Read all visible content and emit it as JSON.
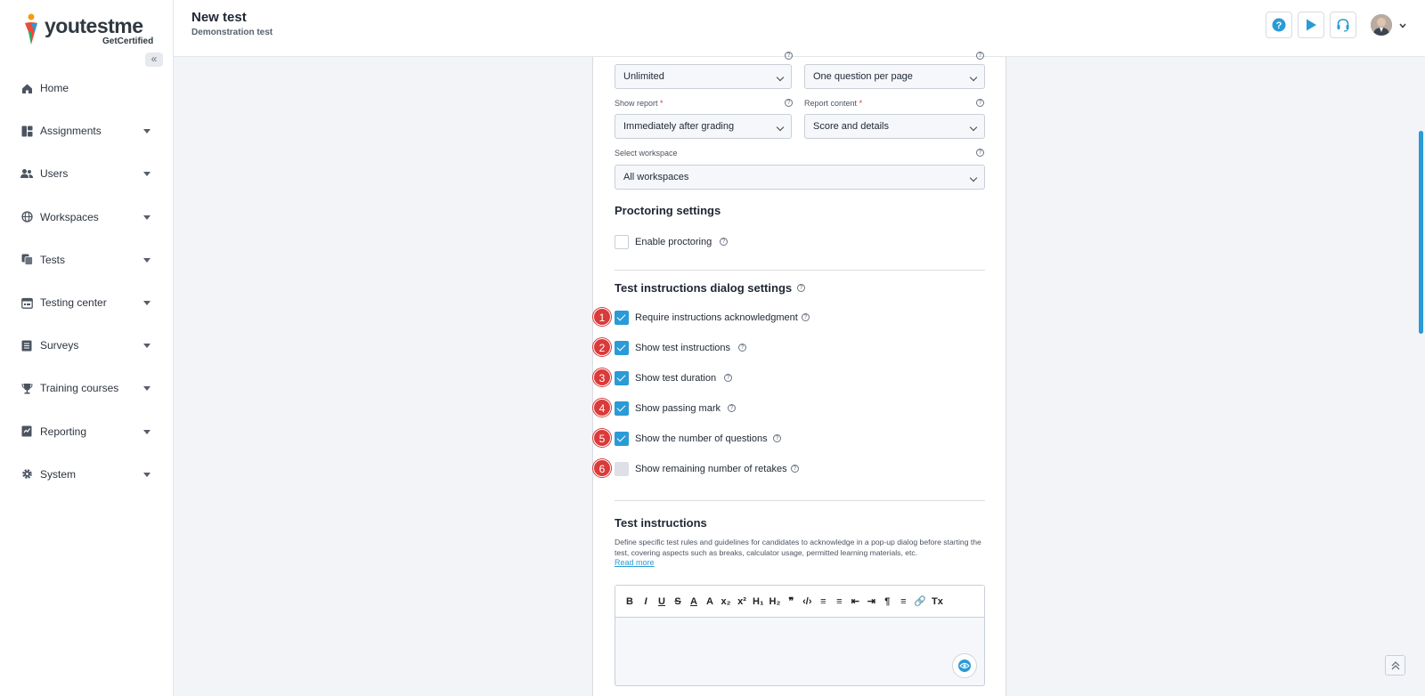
{
  "brand": {
    "logo_text_parts": [
      "y",
      "o",
      "u",
      "t",
      "e",
      "s",
      "t",
      "m",
      "e"
    ],
    "logo_name": "youtestme",
    "logo_sub": "GetCertified",
    "colors": {
      "accent": "#2a9bd6",
      "badge": "#d93a3a"
    }
  },
  "sidebar": {
    "collapse_icon": "double-chevron-left-icon",
    "items": [
      {
        "label": "Home",
        "icon": "home-icon",
        "has_submenu": false
      },
      {
        "label": "Assignments",
        "icon": "dashboard-icon",
        "has_submenu": true
      },
      {
        "label": "Users",
        "icon": "users-icon",
        "has_submenu": true
      },
      {
        "label": "Workspaces",
        "icon": "globe-icon",
        "has_submenu": true
      },
      {
        "label": "Tests",
        "icon": "tests-icon",
        "has_submenu": true
      },
      {
        "label": "Testing center",
        "icon": "calendar-icon",
        "has_submenu": true
      },
      {
        "label": "Surveys",
        "icon": "list-icon",
        "has_submenu": true
      },
      {
        "label": "Training courses",
        "icon": "trophy-icon",
        "has_submenu": true
      },
      {
        "label": "Reporting",
        "icon": "report-icon",
        "has_submenu": true
      },
      {
        "label": "System",
        "icon": "gear-icon",
        "has_submenu": true
      }
    ]
  },
  "header": {
    "title": "New test",
    "subtitle": "Demonstration test",
    "buttons": [
      "help-icon",
      "play-icon",
      "headset-icon"
    ]
  },
  "form": {
    "row1": {
      "left_value": "Unlimited",
      "right_value": "One question per page"
    },
    "show_report": {
      "label": "Show report",
      "required": "*",
      "value": "Immediately after grading"
    },
    "report_content": {
      "label": "Report content",
      "required": "*",
      "value": "Score and details"
    },
    "workspace": {
      "label": "Select workspace",
      "value": "All workspaces"
    }
  },
  "proctoring": {
    "title": "Proctoring settings",
    "enable_label": "Enable proctoring",
    "enabled": false
  },
  "instructions_dialog": {
    "title": "Test instructions dialog settings",
    "options": [
      {
        "badge": "1",
        "label": "Require instructions acknowledgment",
        "checked": true
      },
      {
        "badge": "2",
        "label": "Show test instructions",
        "checked": true
      },
      {
        "badge": "3",
        "label": "Show test duration",
        "checked": true
      },
      {
        "badge": "4",
        "label": "Show passing mark",
        "checked": true
      },
      {
        "badge": "5",
        "label": "Show the number of questions",
        "checked": true
      },
      {
        "badge": "6",
        "label": "Show remaining number of retakes",
        "checked": false
      }
    ]
  },
  "test_instructions": {
    "title": "Test instructions",
    "description": "Define specific test rules and guidelines for candidates to acknowledge in a pop-up dialog before starting the test, covering aspects such as breaks, calculator usage, permitted learning materials, etc.",
    "read_more": "Read more",
    "toolbar": [
      "B",
      "I",
      "U",
      "S",
      "A",
      "A",
      "x₂",
      "x²",
      "H₁",
      "H₂",
      "❞",
      "‹/›",
      "≡",
      "≡",
      "⇤",
      "⇥",
      "¶",
      "≡",
      "🔗",
      "Tx"
    ],
    "toolbar_names": [
      "bold-button",
      "italic-button",
      "underline-button",
      "strikethrough-button",
      "font-color-button",
      "highlight-button",
      "subscript-button",
      "superscript-button",
      "heading1-button",
      "heading2-button",
      "quote-button",
      "code-button",
      "ordered-list-button",
      "bullet-list-button",
      "outdent-button",
      "indent-button",
      "text-direction-button",
      "align-button",
      "link-button",
      "clear-format-button"
    ]
  }
}
